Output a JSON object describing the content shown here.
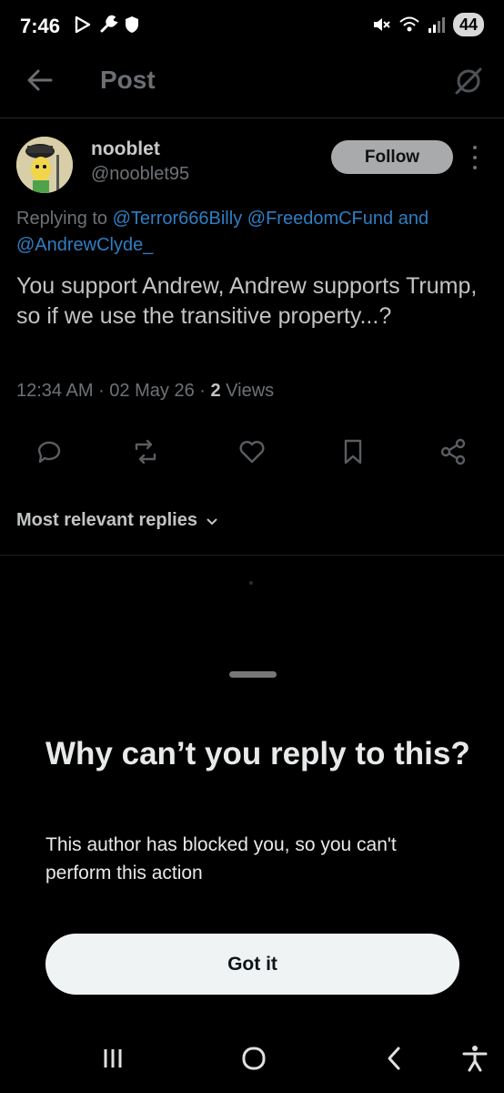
{
  "status_bar": {
    "time": "7:46",
    "battery": "44",
    "icons_left": [
      "play-store-icon",
      "wrench-icon",
      "shield-icon"
    ],
    "icons_right": [
      "mute-icon",
      "wifi-icon",
      "signal-icon",
      "battery-icon"
    ]
  },
  "header": {
    "title": "Post",
    "icons": [
      "back-arrow-icon",
      "grok-icon"
    ]
  },
  "post": {
    "author_name": "nooblet",
    "author_handle": "@nooblet95",
    "follow_label": "Follow",
    "replying_prefix": "Replying to",
    "mentions": [
      "@Terror666Billy",
      "@FreedomCFund"
    ],
    "replying_and": "and",
    "mention_last": "@AndrewClyde_",
    "text": "You support Andrew, Andrew supports Trump, so if we use the transitive property...?",
    "time": "12:34 AM",
    "date": "02 May 26",
    "views_count": "2",
    "views_label": "Views",
    "actions": [
      "reply-icon",
      "repost-icon",
      "like-icon",
      "bookmark-icon",
      "share-icon"
    ],
    "sort_label": "Most relevant replies"
  },
  "sheet": {
    "title": "Why can’t you reply to this?",
    "description": "This author has blocked you, so you can't perform this action",
    "button_label": "Got it"
  },
  "colors": {
    "background": "#000000",
    "mention": "#2f7ec4",
    "button_bg": "#eff3f4"
  }
}
